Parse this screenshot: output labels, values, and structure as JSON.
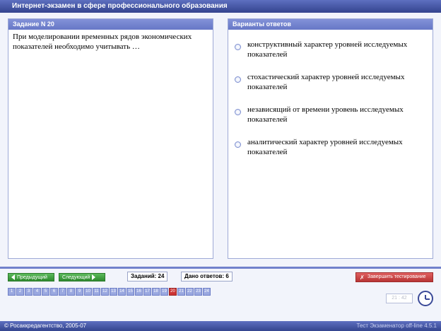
{
  "window": {
    "title": "Интернет-экзамен в сфере профессионального образования"
  },
  "question": {
    "header": "Задание N 20",
    "text": "При моделировании временных рядов экономических показателей необходимо учитывать …"
  },
  "answers": {
    "header": "Варианты ответов",
    "options": [
      "конструктивный характер уровней исследуемых показателей",
      "стохастический характер уровней исследуемых показателей",
      "независящий от времени уровень исследуемых показателей",
      "аналитический характер уровней исследуемых показателей"
    ]
  },
  "nav": {
    "prev_label": "Предыдущий",
    "next_label": "Следующий",
    "tasks_count": "Заданий: 24",
    "answers_given": "Дано ответов: 6",
    "finish_label": "Завершить тестирование",
    "pages": [
      "1",
      "2",
      "3",
      "4",
      "5",
      "6",
      "7",
      "8",
      "9",
      "10",
      "11",
      "12",
      "13",
      "14",
      "15",
      "16",
      "17",
      "18",
      "19",
      "20",
      "21",
      "22",
      "23",
      "24"
    ],
    "current_page": "20",
    "timer": "21 : 42"
  },
  "footer": {
    "left": "© Росаккредагентство, 2005-07",
    "right": "Тест Экзаменатор off-line 4.5.1"
  },
  "colors": {
    "accent": "#4454a8",
    "current_page": "#cc3333",
    "nav_button": "#3a9a3a",
    "finish_button": "#c84040"
  }
}
